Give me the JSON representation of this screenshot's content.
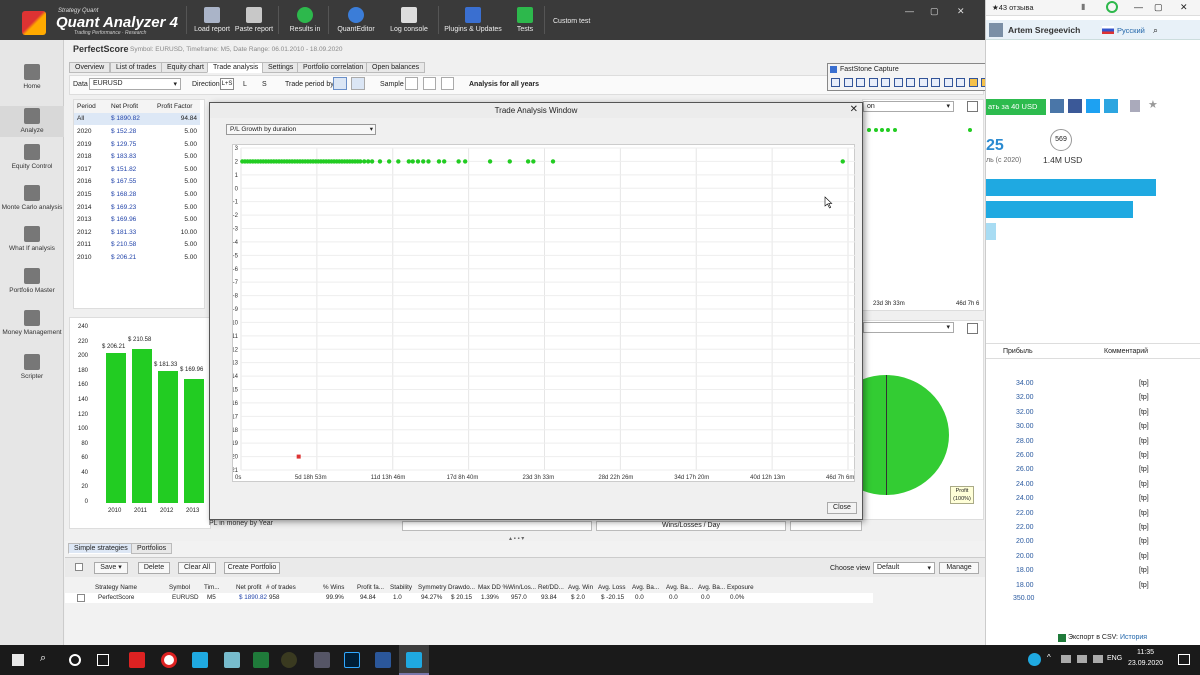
{
  "app": {
    "logo_top": "Strategy Quant",
    "logo_name": "Quant Analyzer 4",
    "logo_sub": "Trading Performance · Research"
  },
  "toolbar": {
    "load_report": "Load report",
    "paste_report": "Paste report",
    "results_in": "Results in",
    "quant_editor": "QuantEditor",
    "log_console": "Log console",
    "plugins": "Plugins & Updates",
    "tests": "Tests",
    "custom_test": "Custom test"
  },
  "sidebar": {
    "home": "Home",
    "analyze": "Analyze",
    "equity_control": "Equity Control",
    "monte_carlo": "Monte Carlo analysis",
    "what_if": "What If analysis",
    "portfolio_master": "Portfolio Master",
    "money_management": "Money Management",
    "scripter": "Scripter"
  },
  "strategy": {
    "name": "PerfectScore",
    "meta": "Symbol: EURUSD, Timeframe: M5, Date Range: 06.01.2010 - 18.09.2020"
  },
  "tabs": [
    "Overview",
    "List of trades",
    "Equity chart",
    "Trade analysis",
    "Settings",
    "Portfolio correlation",
    "Open balances"
  ],
  "filters": {
    "data_label": "Data",
    "data_value": "EURUSD",
    "direction_label": "Direction",
    "dir_ls": "L+S",
    "dir_l": "L",
    "dir_s": "S",
    "trade_period_label": "Trade period by",
    "sample_label": "Sample",
    "analysis_label": "Analysis for all years"
  },
  "period_table": {
    "headers": [
      "Period",
      "Net Profit",
      "Profit Factor"
    ],
    "rows": [
      [
        "All",
        "$ 1890.82",
        "94.84"
      ],
      [
        "2020",
        "$ 152.28",
        "5.00"
      ],
      [
        "2019",
        "$ 129.75",
        "5.00"
      ],
      [
        "2018",
        "$ 183.83",
        "5.00"
      ],
      [
        "2017",
        "$ 151.82",
        "5.00"
      ],
      [
        "2016",
        "$ 167.55",
        "5.00"
      ],
      [
        "2015",
        "$ 168.28",
        "5.00"
      ],
      [
        "2014",
        "$ 169.23",
        "5.00"
      ],
      [
        "2013",
        "$ 169.96",
        "5.00"
      ],
      [
        "2012",
        "$ 181.33",
        "10.00"
      ],
      [
        "2011",
        "$ 210.58",
        "5.00"
      ],
      [
        "2010",
        "$ 206.21",
        "5.00"
      ]
    ]
  },
  "year_chart": {
    "title": "PL in money by Year",
    "y_ticks": [
      "240",
      "220",
      "200",
      "180",
      "160",
      "140",
      "120",
      "100",
      "80",
      "60",
      "40",
      "20",
      "0"
    ],
    "bars": [
      {
        "year": "2010",
        "value": 206.21,
        "label": "$ 206.21"
      },
      {
        "year": "2011",
        "value": 210.58,
        "label": "$ 210.58"
      },
      {
        "year": "2012",
        "value": 181.33,
        "label": "$ 181.33"
      },
      {
        "year": "2013",
        "value": 169.96,
        "label": "$ 169.96"
      }
    ]
  },
  "right_panels": {
    "axis_mid": "23d 3h 33m",
    "axis_end": "46d 7h 6",
    "pie_label": "Profit",
    "pie_pct": "(100%)",
    "wins_losses": "Wins/Losses / Day",
    "dropdown_partial": "on"
  },
  "dialog": {
    "title": "Trade Analysis Window",
    "select_value": "P/L Growth by duration",
    "close_label": "Close"
  },
  "chart_data": {
    "type": "scatter",
    "title": "",
    "xlabel": "",
    "ylabel": "",
    "y_ticks": [
      "3",
      "2",
      "1",
      "0",
      "-1",
      "-2",
      "-3",
      "-4",
      "-5",
      "-6",
      "-7",
      "-8",
      "-9",
      "-10",
      "-11",
      "-12",
      "-13",
      "-14",
      "-15",
      "-16",
      "-17",
      "-18",
      "-19",
      "-20",
      "-21"
    ],
    "ylim": [
      -21,
      3
    ],
    "x_ticks": [
      "0s",
      "5d 18h 53m",
      "11d 13h 46m",
      "17d 8h 40m",
      "23d 3h 33m",
      "28d 22h 26m",
      "34d 17h 20m",
      "40d 12h 13m",
      "46d 7h 6m"
    ],
    "xlim_days": [
      0,
      46.3
    ],
    "series": [
      {
        "color": "#22cc22",
        "points": [
          [
            0.1,
            2
          ],
          [
            0.3,
            2
          ],
          [
            0.5,
            2
          ],
          [
            0.7,
            2
          ],
          [
            0.9,
            2
          ],
          [
            1.1,
            2
          ],
          [
            1.3,
            2
          ],
          [
            1.5,
            2
          ],
          [
            1.7,
            2
          ],
          [
            1.9,
            2
          ],
          [
            2.1,
            2
          ],
          [
            2.3,
            2
          ],
          [
            2.5,
            2
          ],
          [
            2.7,
            2
          ],
          [
            2.9,
            2
          ],
          [
            3.1,
            2
          ],
          [
            3.3,
            2
          ],
          [
            3.5,
            2
          ],
          [
            3.7,
            2
          ],
          [
            3.9,
            2
          ],
          [
            4.1,
            2
          ],
          [
            4.3,
            2
          ],
          [
            4.5,
            2
          ],
          [
            4.7,
            2
          ],
          [
            4.9,
            2
          ],
          [
            5.1,
            2
          ],
          [
            5.3,
            2
          ],
          [
            5.5,
            2
          ],
          [
            5.7,
            2
          ],
          [
            5.9,
            2
          ],
          [
            6.1,
            2
          ],
          [
            6.3,
            2
          ],
          [
            6.5,
            2
          ],
          [
            6.7,
            2
          ],
          [
            6.9,
            2
          ],
          [
            7.1,
            2
          ],
          [
            7.3,
            2
          ],
          [
            7.5,
            2
          ],
          [
            7.7,
            2
          ],
          [
            7.9,
            2
          ],
          [
            8.1,
            2
          ],
          [
            8.3,
            2
          ],
          [
            8.5,
            2
          ],
          [
            8.7,
            2
          ],
          [
            8.9,
            2
          ],
          [
            9.1,
            2
          ],
          [
            9.4,
            2
          ],
          [
            9.7,
            2
          ],
          [
            10.0,
            2
          ],
          [
            10.6,
            2
          ],
          [
            11.3,
            2
          ],
          [
            12.0,
            2
          ],
          [
            12.8,
            2
          ],
          [
            13.1,
            2
          ],
          [
            13.5,
            2
          ],
          [
            13.9,
            2
          ],
          [
            14.3,
            2
          ],
          [
            15.1,
            2
          ],
          [
            15.5,
            2
          ],
          [
            16.6,
            2
          ],
          [
            17.1,
            2
          ],
          [
            19.0,
            2
          ],
          [
            20.5,
            2
          ],
          [
            21.9,
            2
          ],
          [
            22.3,
            2
          ],
          [
            23.8,
            2
          ],
          [
            45.9,
            2
          ]
        ]
      },
      {
        "color": "#dd3333",
        "points": [
          [
            4.4,
            -20
          ]
        ]
      }
    ]
  },
  "bottom": {
    "tabs": [
      "Simple strategies",
      "Portfolios"
    ],
    "save": "Save",
    "delete": "Delete",
    "clear_all": "Clear All",
    "create_portfolio": "Create Portfolio",
    "choose_view_label": "Choose view",
    "choose_view_value": "Default",
    "manage": "Manage",
    "headers": [
      "Strategy Name",
      "Symbol",
      "Tim...",
      "Net profit",
      "# of trades",
      "% Wins",
      "Profit fa...",
      "Stability",
      "Symmetry",
      "Drawdo...",
      "Max DD %",
      "Win/Los...",
      "Ret/DD...",
      "Avg. Win",
      "Avg. Loss",
      "Avg. Ba...",
      "Avg. Ba...",
      "Avg. Ba...",
      "Exposure"
    ],
    "row": [
      "PerfectScore",
      "EURUSD",
      "M5",
      "$ 1890.82",
      "958",
      "99.9%",
      "94.84",
      "1.0",
      "94.27%",
      "$ 20.15",
      "1.39%",
      "957.0",
      "93.84",
      "$ 2.0",
      "$ -20.15",
      "0.0",
      "0.0",
      "0.0",
      "0.0%"
    ]
  },
  "browser": {
    "reviews": "★43 отзыва",
    "user": "Artem Sregeevich",
    "language": "Русский",
    "buy_button": "ать за 40 USD",
    "stat1": "25",
    "stat1_sub": "ль (с 2020)",
    "stat2_badge": "569",
    "stat2": "1.4M USD",
    "col_profit": "Прибыль",
    "col_comment": "Комментарий",
    "rows": [
      [
        "34.00",
        "[tp]"
      ],
      [
        "32.00",
        "[tp]"
      ],
      [
        "32.00",
        "[tp]"
      ],
      [
        "30.00",
        "[tp]"
      ],
      [
        "28.00",
        "[tp]"
      ],
      [
        "26.00",
        "[tp]"
      ],
      [
        "26.00",
        "[tp]"
      ],
      [
        "24.00",
        "[tp]"
      ],
      [
        "24.00",
        "[tp]"
      ],
      [
        "22.00",
        "[tp]"
      ],
      [
        "22.00",
        "[tp]"
      ],
      [
        "20.00",
        "[tp]"
      ],
      [
        "20.00",
        "[tp]"
      ],
      [
        "18.00",
        "[tp]"
      ],
      [
        "18.00",
        "[tp]"
      ]
    ],
    "total": "350.00",
    "export_label": "Экспорт в CSV:",
    "export_link": "История"
  },
  "faststone": {
    "title": "FastStone Capture"
  },
  "taskbar": {
    "lang": "ENG",
    "time": "11:35",
    "date": "23.09.2020"
  },
  "colors": {
    "point_green": "#22cc22",
    "point_red": "#dd3333",
    "link_blue": "#2244aa",
    "progress_blue": "#1fa9e1",
    "browser_green": "#2dbb4e"
  }
}
